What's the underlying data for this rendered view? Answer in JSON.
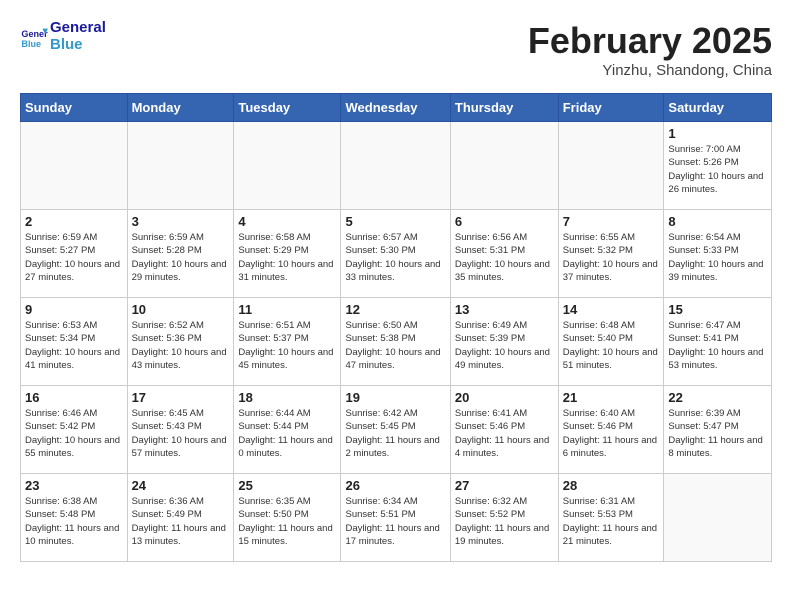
{
  "logo": {
    "text_general": "General",
    "text_blue": "Blue"
  },
  "header": {
    "month": "February 2025",
    "location": "Yinzhu, Shandong, China"
  },
  "weekdays": [
    "Sunday",
    "Monday",
    "Tuesday",
    "Wednesday",
    "Thursday",
    "Friday",
    "Saturday"
  ],
  "weeks": [
    [
      {
        "day": "",
        "info": ""
      },
      {
        "day": "",
        "info": ""
      },
      {
        "day": "",
        "info": ""
      },
      {
        "day": "",
        "info": ""
      },
      {
        "day": "",
        "info": ""
      },
      {
        "day": "",
        "info": ""
      },
      {
        "day": "1",
        "info": "Sunrise: 7:00 AM\nSunset: 5:26 PM\nDaylight: 10 hours and 26 minutes."
      }
    ],
    [
      {
        "day": "2",
        "info": "Sunrise: 6:59 AM\nSunset: 5:27 PM\nDaylight: 10 hours and 27 minutes."
      },
      {
        "day": "3",
        "info": "Sunrise: 6:59 AM\nSunset: 5:28 PM\nDaylight: 10 hours and 29 minutes."
      },
      {
        "day": "4",
        "info": "Sunrise: 6:58 AM\nSunset: 5:29 PM\nDaylight: 10 hours and 31 minutes."
      },
      {
        "day": "5",
        "info": "Sunrise: 6:57 AM\nSunset: 5:30 PM\nDaylight: 10 hours and 33 minutes."
      },
      {
        "day": "6",
        "info": "Sunrise: 6:56 AM\nSunset: 5:31 PM\nDaylight: 10 hours and 35 minutes."
      },
      {
        "day": "7",
        "info": "Sunrise: 6:55 AM\nSunset: 5:32 PM\nDaylight: 10 hours and 37 minutes."
      },
      {
        "day": "8",
        "info": "Sunrise: 6:54 AM\nSunset: 5:33 PM\nDaylight: 10 hours and 39 minutes."
      }
    ],
    [
      {
        "day": "9",
        "info": "Sunrise: 6:53 AM\nSunset: 5:34 PM\nDaylight: 10 hours and 41 minutes."
      },
      {
        "day": "10",
        "info": "Sunrise: 6:52 AM\nSunset: 5:36 PM\nDaylight: 10 hours and 43 minutes."
      },
      {
        "day": "11",
        "info": "Sunrise: 6:51 AM\nSunset: 5:37 PM\nDaylight: 10 hours and 45 minutes."
      },
      {
        "day": "12",
        "info": "Sunrise: 6:50 AM\nSunset: 5:38 PM\nDaylight: 10 hours and 47 minutes."
      },
      {
        "day": "13",
        "info": "Sunrise: 6:49 AM\nSunset: 5:39 PM\nDaylight: 10 hours and 49 minutes."
      },
      {
        "day": "14",
        "info": "Sunrise: 6:48 AM\nSunset: 5:40 PM\nDaylight: 10 hours and 51 minutes."
      },
      {
        "day": "15",
        "info": "Sunrise: 6:47 AM\nSunset: 5:41 PM\nDaylight: 10 hours and 53 minutes."
      }
    ],
    [
      {
        "day": "16",
        "info": "Sunrise: 6:46 AM\nSunset: 5:42 PM\nDaylight: 10 hours and 55 minutes."
      },
      {
        "day": "17",
        "info": "Sunrise: 6:45 AM\nSunset: 5:43 PM\nDaylight: 10 hours and 57 minutes."
      },
      {
        "day": "18",
        "info": "Sunrise: 6:44 AM\nSunset: 5:44 PM\nDaylight: 11 hours and 0 minutes."
      },
      {
        "day": "19",
        "info": "Sunrise: 6:42 AM\nSunset: 5:45 PM\nDaylight: 11 hours and 2 minutes."
      },
      {
        "day": "20",
        "info": "Sunrise: 6:41 AM\nSunset: 5:46 PM\nDaylight: 11 hours and 4 minutes."
      },
      {
        "day": "21",
        "info": "Sunrise: 6:40 AM\nSunset: 5:46 PM\nDaylight: 11 hours and 6 minutes."
      },
      {
        "day": "22",
        "info": "Sunrise: 6:39 AM\nSunset: 5:47 PM\nDaylight: 11 hours and 8 minutes."
      }
    ],
    [
      {
        "day": "23",
        "info": "Sunrise: 6:38 AM\nSunset: 5:48 PM\nDaylight: 11 hours and 10 minutes."
      },
      {
        "day": "24",
        "info": "Sunrise: 6:36 AM\nSunset: 5:49 PM\nDaylight: 11 hours and 13 minutes."
      },
      {
        "day": "25",
        "info": "Sunrise: 6:35 AM\nSunset: 5:50 PM\nDaylight: 11 hours and 15 minutes."
      },
      {
        "day": "26",
        "info": "Sunrise: 6:34 AM\nSunset: 5:51 PM\nDaylight: 11 hours and 17 minutes."
      },
      {
        "day": "27",
        "info": "Sunrise: 6:32 AM\nSunset: 5:52 PM\nDaylight: 11 hours and 19 minutes."
      },
      {
        "day": "28",
        "info": "Sunrise: 6:31 AM\nSunset: 5:53 PM\nDaylight: 11 hours and 21 minutes."
      },
      {
        "day": "",
        "info": ""
      }
    ]
  ]
}
